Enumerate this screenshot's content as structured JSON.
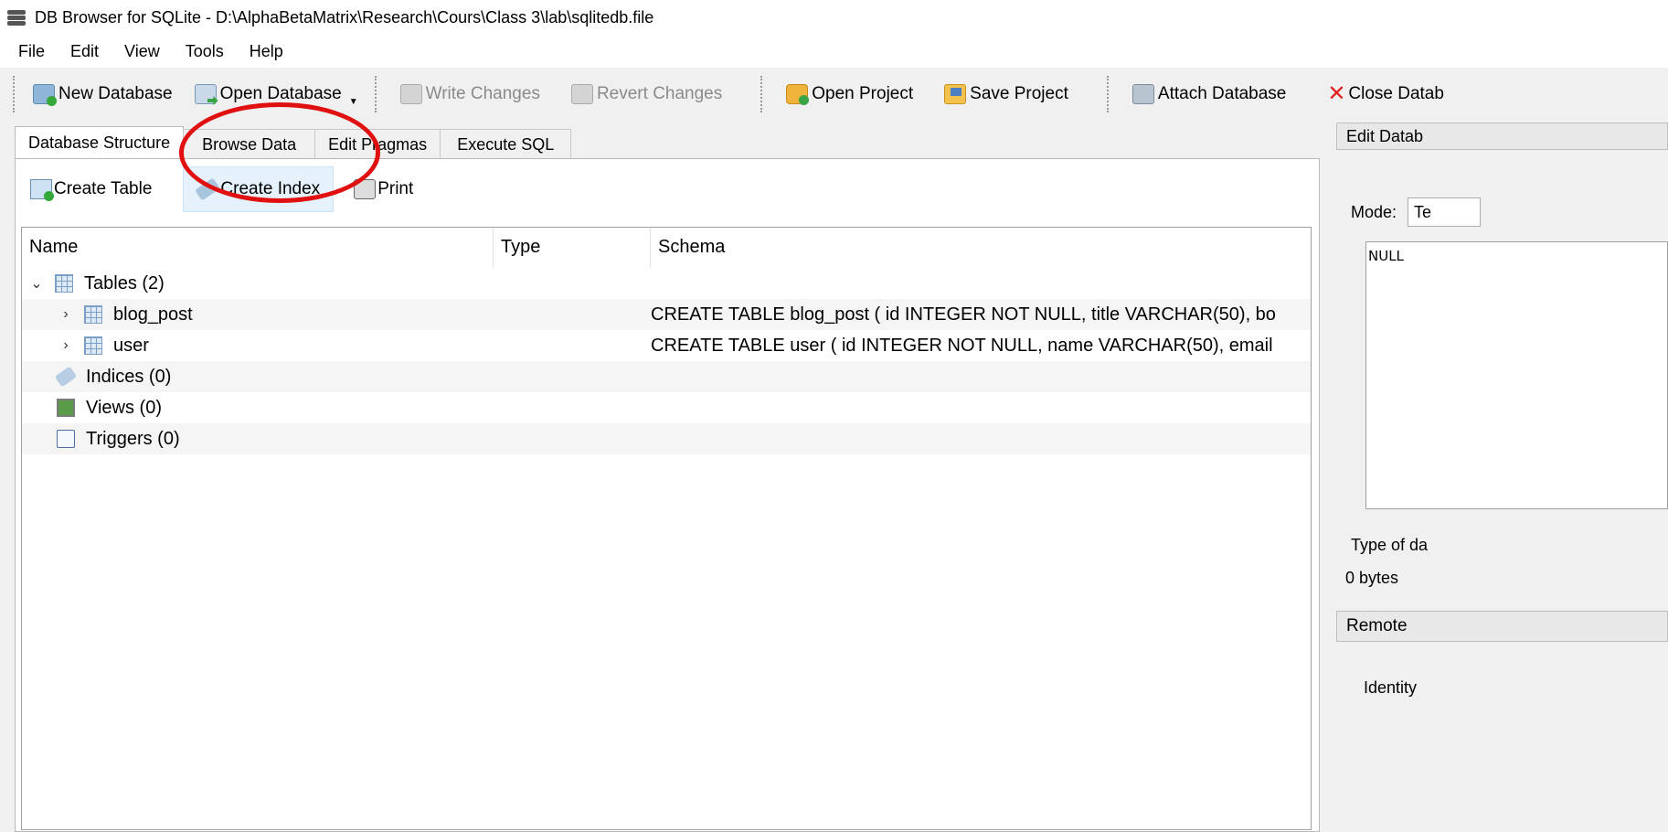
{
  "window": {
    "title": "DB Browser for SQLite - D:\\AlphaBetaMatrix\\Research\\Cours\\Class 3\\lab\\sqlitedb.file"
  },
  "menu": [
    "File",
    "Edit",
    "View",
    "Tools",
    "Help"
  ],
  "toolbar": {
    "new_database": "New Database",
    "open_database": "Open Database",
    "write_changes": "Write Changes",
    "revert_changes": "Revert Changes",
    "open_project": "Open Project",
    "save_project": "Save Project",
    "attach_database": "Attach Database",
    "close_database": "Close Datab"
  },
  "tabs": [
    "Database Structure",
    "Browse Data",
    "Edit Pragmas",
    "Execute SQL"
  ],
  "structure_toolbar": {
    "create_table": "Create Table",
    "create_index": "Create Index",
    "print": "Print"
  },
  "tree": {
    "headers": {
      "name": "Name",
      "type": "Type",
      "schema": "Schema"
    },
    "tables_group": "Tables (2)",
    "tables": [
      {
        "name": "blog_post",
        "schema": "CREATE TABLE blog_post ( id INTEGER NOT NULL, title VARCHAR(50), bo"
      },
      {
        "name": "user",
        "schema": "CREATE TABLE user ( id INTEGER NOT NULL, name VARCHAR(50), email"
      }
    ],
    "indices": "Indices (0)",
    "views": "Views (0)",
    "triggers": "Triggers (0)"
  },
  "right_panel": {
    "header": "Edit Datab",
    "mode_label": "Mode:",
    "mode_value": "Te",
    "editor_value": "NULL",
    "type_label": "Type of da",
    "size": "0 bytes",
    "remote": "Remote",
    "identity": "Identity"
  },
  "colors": {
    "annotation": "#e01010",
    "accent_hover": "#e5f1fb"
  }
}
